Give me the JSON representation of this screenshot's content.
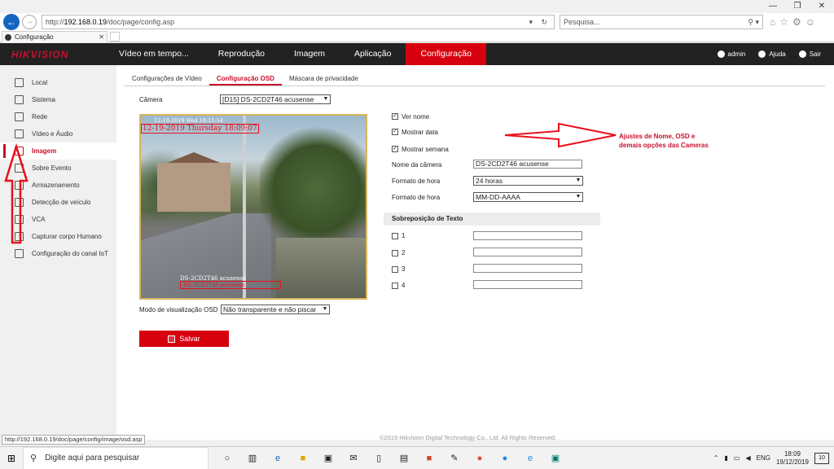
{
  "window": {
    "minimize": "—",
    "restore": "❐",
    "close": "✕"
  },
  "browser": {
    "back": "←",
    "forward": "→",
    "url_prefix": "http://",
    "url_host": "192.168.0.19",
    "url_path": "/doc/page/config.asp",
    "url_tools": "▾ ↻",
    "search_placeholder": "Pesquisa...",
    "search_tools": "⚲ ▾",
    "toolbar_icons": [
      "⌂",
      "☆",
      "⚙",
      "☺"
    ],
    "tab_title": "Configuração",
    "tab_close": "✕",
    "status_url": "http://192.168.0.19/doc/page/config/image/osd.asp"
  },
  "header": {
    "logo": "HIKVISION",
    "nav": [
      {
        "label": "Vídeo em tempo...",
        "active": false
      },
      {
        "label": "Reprodução",
        "active": false
      },
      {
        "label": "Imagem",
        "active": false
      },
      {
        "label": "Aplicação",
        "active": false
      },
      {
        "label": "Configuração",
        "active": true
      }
    ],
    "user": "admin",
    "help": "Ajuda",
    "logout": "Sair"
  },
  "sidebar": {
    "items": [
      {
        "label": "Local",
        "icon": "monitor-icon"
      },
      {
        "label": "Sistema",
        "icon": "system-icon"
      },
      {
        "label": "Rede",
        "icon": "network-icon"
      },
      {
        "label": "Vídeo e Áudio",
        "icon": "audio-video-icon"
      },
      {
        "label": "Imagem",
        "icon": "image-icon",
        "active": true
      },
      {
        "label": "Sobre Evento",
        "icon": "event-icon"
      },
      {
        "label": "Armazenamento",
        "icon": "storage-icon"
      },
      {
        "label": "Detecção de veículo",
        "icon": "vehicle-icon"
      },
      {
        "label": "VCA",
        "icon": "vca-icon"
      },
      {
        "label": "Capturar corpo Humano",
        "icon": "human-body-icon"
      },
      {
        "label": "Configuração do canal IoT",
        "icon": "iot-icon"
      }
    ]
  },
  "subtabs": [
    {
      "label": "Configurações de Vídeo",
      "active": false
    },
    {
      "label": "Configuração OSD",
      "active": true
    },
    {
      "label": "Máscara de privacidade",
      "active": false
    }
  ],
  "camera": {
    "label": "Câmera",
    "value": "[D15] DS-2CD2T46 acusense"
  },
  "video": {
    "osd_date": "12-19-2019 Thursday 18:09:07",
    "osd_ghost": "12-19-2019 Wed 18:11:54",
    "osd_name": "DS-2CD2T46 acusense",
    "osd_name_box": "DS-2CD2T46 acusense"
  },
  "display_mode": {
    "label": "Modo de visualização OSD",
    "value": "Não transparente e não piscar"
  },
  "save_label": "Salvar",
  "options": {
    "show_name": {
      "label": "Ver nome",
      "checked": true
    },
    "show_date": {
      "label": "Mostrar data",
      "checked": true
    },
    "show_week": {
      "label": "Mostrar semana",
      "checked": true
    },
    "camera_name": {
      "label": "Nome da câmera",
      "value": "DS-2CD2T46 acusense"
    },
    "time_format": {
      "label": "Formato de hora",
      "value": "24 horas"
    },
    "date_format": {
      "label": "Formato de hora",
      "value": "MM-DD-AAAA"
    }
  },
  "text_overlay": {
    "title": "Sobreposição de Texto",
    "rows": [
      {
        "label": "1"
      },
      {
        "label": "2"
      },
      {
        "label": "3"
      },
      {
        "label": "4"
      }
    ]
  },
  "annotation": "Ajustes de Nome, OSD e demais opções das Cameras",
  "footer": "©2019 Hikvision Digital Technology Co., Ltd. All Rights Reserved.",
  "taskbar": {
    "search_placeholder": "Digite aqui para pesquisar",
    "language": "ENG",
    "time": "18:09",
    "date": "19/12/2019",
    "notifications": "10"
  }
}
